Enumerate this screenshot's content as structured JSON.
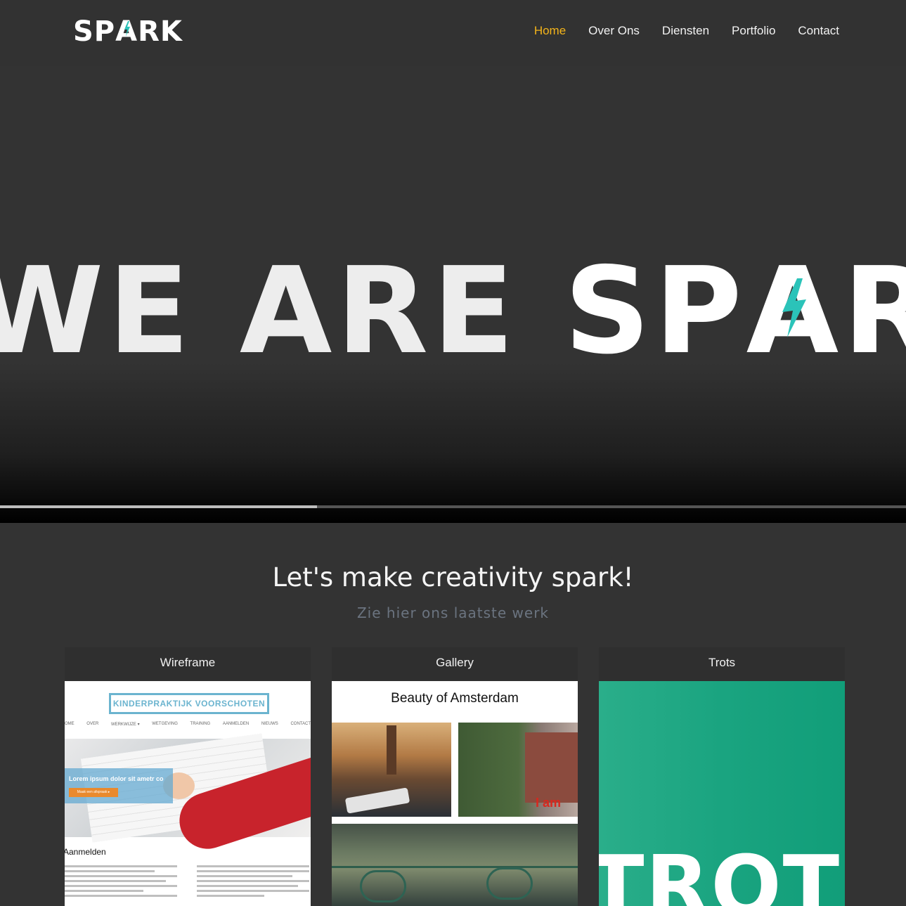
{
  "nav": {
    "logo": "SPARK",
    "items": [
      {
        "label": "Home",
        "active": true
      },
      {
        "label": "Over Ons",
        "active": false
      },
      {
        "label": "Diensten",
        "active": false
      },
      {
        "label": "Portfolio",
        "active": false
      },
      {
        "label": "Contact",
        "active": false
      }
    ],
    "active_color": "#f4b41a"
  },
  "hero": {
    "text_part1": "WE ARE ",
    "text_part2": "SPARK",
    "accent_color": "#2bc3b9",
    "video_progress": 0.35
  },
  "section": {
    "title": "Let's make creativity spark!",
    "subtitle": "Zie hier ons laatste werk"
  },
  "cards": [
    {
      "title": "Wireframe",
      "preview": {
        "logo": "KINDERPRAKTIJK VOORSCHOTEN",
        "menu": [
          "OME",
          "OVER",
          "WERKWIJZE ▾",
          "WETGEVING",
          "TRAINING",
          "AANMELDEN",
          "NIEUWS",
          "CONTACT"
        ],
        "banner": "Lorem ipsum dolor sit ametr co",
        "button": "Maak een afspraak ▸",
        "heading": "Aanmelden"
      }
    },
    {
      "title": "Gallery",
      "preview": {
        "heading": "Beauty of Amsterdam",
        "sign": "I am"
      }
    },
    {
      "title": "Trots",
      "preview": {
        "text": "TROTS"
      }
    }
  ]
}
